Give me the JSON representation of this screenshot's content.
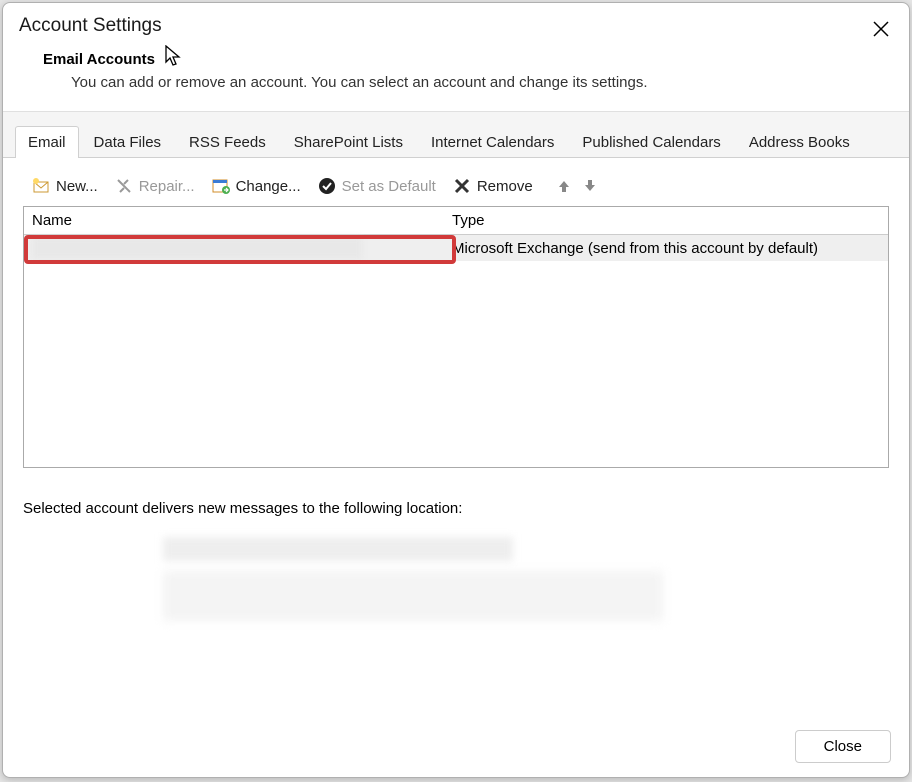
{
  "window": {
    "title": "Account Settings"
  },
  "subheader": {
    "title": "Email Accounts",
    "desc": "You can add or remove an account. You can select an account and change its settings."
  },
  "tabs": [
    {
      "label": "Email",
      "active": true
    },
    {
      "label": "Data Files"
    },
    {
      "label": "RSS Feeds"
    },
    {
      "label": "SharePoint Lists"
    },
    {
      "label": "Internet Calendars"
    },
    {
      "label": "Published Calendars"
    },
    {
      "label": "Address Books"
    }
  ],
  "toolbar": {
    "new": "New...",
    "repair": "Repair...",
    "change": "Change...",
    "setdefault": "Set as Default",
    "remove": "Remove"
  },
  "grid": {
    "col_name": "Name",
    "col_type": "Type",
    "row_type": "Microsoft Exchange (send from this account by default)"
  },
  "location_text": "Selected account delivers new messages to the following location:",
  "footer": {
    "close": "Close"
  }
}
